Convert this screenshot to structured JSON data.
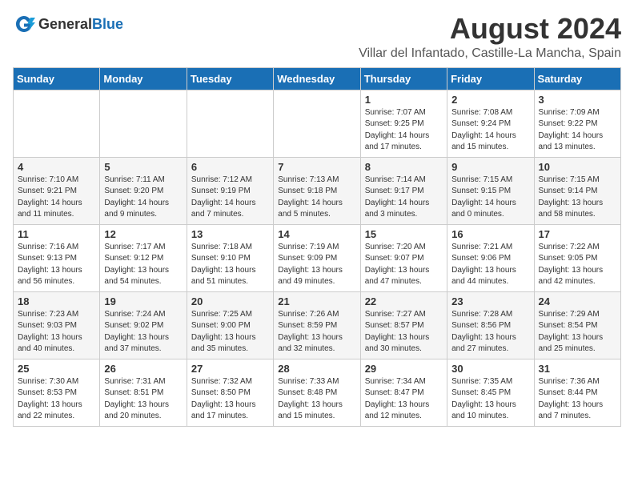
{
  "logo": {
    "general": "General",
    "blue": "Blue"
  },
  "title": "August 2024",
  "subtitle": "Villar del Infantado, Castille-La Mancha, Spain",
  "weekdays": [
    "Sunday",
    "Monday",
    "Tuesday",
    "Wednesday",
    "Thursday",
    "Friday",
    "Saturday"
  ],
  "weeks": [
    [
      {
        "day": "",
        "info": ""
      },
      {
        "day": "",
        "info": ""
      },
      {
        "day": "",
        "info": ""
      },
      {
        "day": "",
        "info": ""
      },
      {
        "day": "1",
        "info": "Sunrise: 7:07 AM\nSunset: 9:25 PM\nDaylight: 14 hours\nand 17 minutes."
      },
      {
        "day": "2",
        "info": "Sunrise: 7:08 AM\nSunset: 9:24 PM\nDaylight: 14 hours\nand 15 minutes."
      },
      {
        "day": "3",
        "info": "Sunrise: 7:09 AM\nSunset: 9:22 PM\nDaylight: 14 hours\nand 13 minutes."
      }
    ],
    [
      {
        "day": "4",
        "info": "Sunrise: 7:10 AM\nSunset: 9:21 PM\nDaylight: 14 hours\nand 11 minutes."
      },
      {
        "day": "5",
        "info": "Sunrise: 7:11 AM\nSunset: 9:20 PM\nDaylight: 14 hours\nand 9 minutes."
      },
      {
        "day": "6",
        "info": "Sunrise: 7:12 AM\nSunset: 9:19 PM\nDaylight: 14 hours\nand 7 minutes."
      },
      {
        "day": "7",
        "info": "Sunrise: 7:13 AM\nSunset: 9:18 PM\nDaylight: 14 hours\nand 5 minutes."
      },
      {
        "day": "8",
        "info": "Sunrise: 7:14 AM\nSunset: 9:17 PM\nDaylight: 14 hours\nand 3 minutes."
      },
      {
        "day": "9",
        "info": "Sunrise: 7:15 AM\nSunset: 9:15 PM\nDaylight: 14 hours\nand 0 minutes."
      },
      {
        "day": "10",
        "info": "Sunrise: 7:15 AM\nSunset: 9:14 PM\nDaylight: 13 hours\nand 58 minutes."
      }
    ],
    [
      {
        "day": "11",
        "info": "Sunrise: 7:16 AM\nSunset: 9:13 PM\nDaylight: 13 hours\nand 56 minutes."
      },
      {
        "day": "12",
        "info": "Sunrise: 7:17 AM\nSunset: 9:12 PM\nDaylight: 13 hours\nand 54 minutes."
      },
      {
        "day": "13",
        "info": "Sunrise: 7:18 AM\nSunset: 9:10 PM\nDaylight: 13 hours\nand 51 minutes."
      },
      {
        "day": "14",
        "info": "Sunrise: 7:19 AM\nSunset: 9:09 PM\nDaylight: 13 hours\nand 49 minutes."
      },
      {
        "day": "15",
        "info": "Sunrise: 7:20 AM\nSunset: 9:07 PM\nDaylight: 13 hours\nand 47 minutes."
      },
      {
        "day": "16",
        "info": "Sunrise: 7:21 AM\nSunset: 9:06 PM\nDaylight: 13 hours\nand 44 minutes."
      },
      {
        "day": "17",
        "info": "Sunrise: 7:22 AM\nSunset: 9:05 PM\nDaylight: 13 hours\nand 42 minutes."
      }
    ],
    [
      {
        "day": "18",
        "info": "Sunrise: 7:23 AM\nSunset: 9:03 PM\nDaylight: 13 hours\nand 40 minutes."
      },
      {
        "day": "19",
        "info": "Sunrise: 7:24 AM\nSunset: 9:02 PM\nDaylight: 13 hours\nand 37 minutes."
      },
      {
        "day": "20",
        "info": "Sunrise: 7:25 AM\nSunset: 9:00 PM\nDaylight: 13 hours\nand 35 minutes."
      },
      {
        "day": "21",
        "info": "Sunrise: 7:26 AM\nSunset: 8:59 PM\nDaylight: 13 hours\nand 32 minutes."
      },
      {
        "day": "22",
        "info": "Sunrise: 7:27 AM\nSunset: 8:57 PM\nDaylight: 13 hours\nand 30 minutes."
      },
      {
        "day": "23",
        "info": "Sunrise: 7:28 AM\nSunset: 8:56 PM\nDaylight: 13 hours\nand 27 minutes."
      },
      {
        "day": "24",
        "info": "Sunrise: 7:29 AM\nSunset: 8:54 PM\nDaylight: 13 hours\nand 25 minutes."
      }
    ],
    [
      {
        "day": "25",
        "info": "Sunrise: 7:30 AM\nSunset: 8:53 PM\nDaylight: 13 hours\nand 22 minutes."
      },
      {
        "day": "26",
        "info": "Sunrise: 7:31 AM\nSunset: 8:51 PM\nDaylight: 13 hours\nand 20 minutes."
      },
      {
        "day": "27",
        "info": "Sunrise: 7:32 AM\nSunset: 8:50 PM\nDaylight: 13 hours\nand 17 minutes."
      },
      {
        "day": "28",
        "info": "Sunrise: 7:33 AM\nSunset: 8:48 PM\nDaylight: 13 hours\nand 15 minutes."
      },
      {
        "day": "29",
        "info": "Sunrise: 7:34 AM\nSunset: 8:47 PM\nDaylight: 13 hours\nand 12 minutes."
      },
      {
        "day": "30",
        "info": "Sunrise: 7:35 AM\nSunset: 8:45 PM\nDaylight: 13 hours\nand 10 minutes."
      },
      {
        "day": "31",
        "info": "Sunrise: 7:36 AM\nSunset: 8:44 PM\nDaylight: 13 hours\nand 7 minutes."
      }
    ]
  ]
}
